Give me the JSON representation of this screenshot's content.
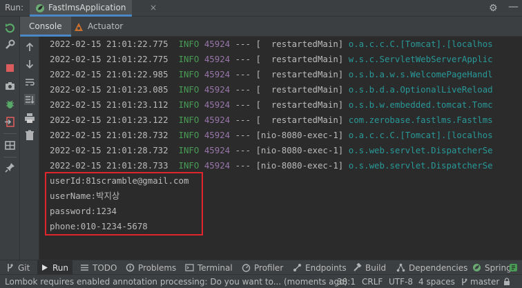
{
  "runbar": {
    "run_label": "Run:",
    "tab_title": "FastlmsApplication",
    "close_glyph": "×",
    "gear_glyph": "⚙",
    "minimize_glyph": "—"
  },
  "subtabs": {
    "console": "Console",
    "actuator": "Actuator"
  },
  "log_lines": [
    {
      "ts": "2022-02-15 21:01:22.775",
      "level": "INFO",
      "pid": "45924",
      "sep": "---",
      "thread": "[  restartedMain]",
      "logger": "o.a.c.c.C.[Tomcat].[localhos"
    },
    {
      "ts": "2022-02-15 21:01:22.775",
      "level": "INFO",
      "pid": "45924",
      "sep": "---",
      "thread": "[  restartedMain]",
      "logger": "w.s.c.ServletWebServerApplic"
    },
    {
      "ts": "2022-02-15 21:01:22.985",
      "level": "INFO",
      "pid": "45924",
      "sep": "---",
      "thread": "[  restartedMain]",
      "logger": "o.s.b.a.w.s.WelcomePageHandl"
    },
    {
      "ts": "2022-02-15 21:01:23.085",
      "level": "INFO",
      "pid": "45924",
      "sep": "---",
      "thread": "[  restartedMain]",
      "logger": "o.s.b.d.a.OptionalLiveReload"
    },
    {
      "ts": "2022-02-15 21:01:23.112",
      "level": "INFO",
      "pid": "45924",
      "sep": "---",
      "thread": "[  restartedMain]",
      "logger": "o.s.b.w.embedded.tomcat.Tomc"
    },
    {
      "ts": "2022-02-15 21:01:23.122",
      "level": "INFO",
      "pid": "45924",
      "sep": "---",
      "thread": "[  restartedMain]",
      "logger": "com.zerobase.fastlms.Fastlms"
    },
    {
      "ts": "2022-02-15 21:01:28.732",
      "level": "INFO",
      "pid": "45924",
      "sep": "---",
      "thread": "[nio-8080-exec-1]",
      "logger": "o.a.c.c.C.[Tomcat].[localhos"
    },
    {
      "ts": "2022-02-15 21:01:28.732",
      "level": "INFO",
      "pid": "45924",
      "sep": "---",
      "thread": "[nio-8080-exec-1]",
      "logger": "o.s.web.servlet.DispatcherSe"
    },
    {
      "ts": "2022-02-15 21:01:28.733",
      "level": "INFO",
      "pid": "45924",
      "sep": "---",
      "thread": "[nio-8080-exec-1]",
      "logger": "o.s.web.servlet.DispatcherSe"
    }
  ],
  "output_lines": [
    "userId:81scramble@gmail.com",
    "userName:박지상",
    "password:1234",
    "phone:010-1234-5678"
  ],
  "toolwindows": {
    "git": "Git",
    "run": "Run",
    "todo": "TODO",
    "problems": "Problems",
    "terminal": "Terminal",
    "profiler": "Profiler",
    "endpoints": "Endpoints",
    "build": "Build",
    "dependencies": "Dependencies",
    "spring": "Spring"
  },
  "statusbar": {
    "message": "Lombok requires enabled annotation processing: Do you want to... (moments ago)",
    "position": "38:1",
    "line_ending": "CRLF",
    "encoding": "UTF-8",
    "indent": "4 spaces",
    "branch": "master"
  },
  "colors": {
    "accent": "#4a88c7",
    "highlight_box": "#e0262b",
    "info_level": "#499c54",
    "pid": "#9876aa",
    "logger": "#299999"
  }
}
